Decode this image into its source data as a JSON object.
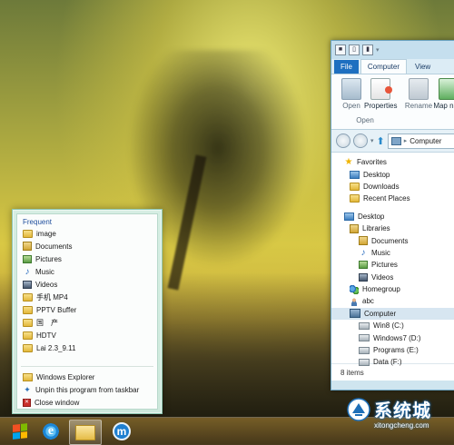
{
  "explorer": {
    "tabs": [
      "File",
      "Computer",
      "View"
    ],
    "ribbon": {
      "open_label": "Open",
      "properties_label": "Properties",
      "rename_label": "Rename",
      "map_label": "Map n dri",
      "group_label": "Open"
    },
    "address": {
      "path": "Computer"
    },
    "nav": {
      "favorites": "Favorites",
      "desktop_fav": "Desktop",
      "downloads": "Downloads",
      "recent": "Recent Places",
      "desktop": "Desktop",
      "libraries": "Libraries",
      "documents": "Documents",
      "music": "Music",
      "pictures": "Pictures",
      "videos": "Videos",
      "homegroup": "Homegroup",
      "user": "abc",
      "computer": "Computer",
      "drives": [
        "Win8 (C:)",
        "Windows7 (D:)",
        "Programs (E:)",
        "Data (F:)"
      ]
    },
    "status": "8 items"
  },
  "jumplist": {
    "header": "Frequent",
    "frequent": [
      "image",
      "Documents",
      "Pictures",
      "Music",
      "Videos",
      "手机 MP4",
      "PPTV Buffer",
      "国　产",
      "HDTV",
      "Lai 2.3_9.11"
    ],
    "tasks": [
      "Windows Explorer",
      "Unpin this program from taskbar",
      "Close window"
    ]
  },
  "watermark": {
    "title": "系统城",
    "url": "xitongcheng.com"
  }
}
